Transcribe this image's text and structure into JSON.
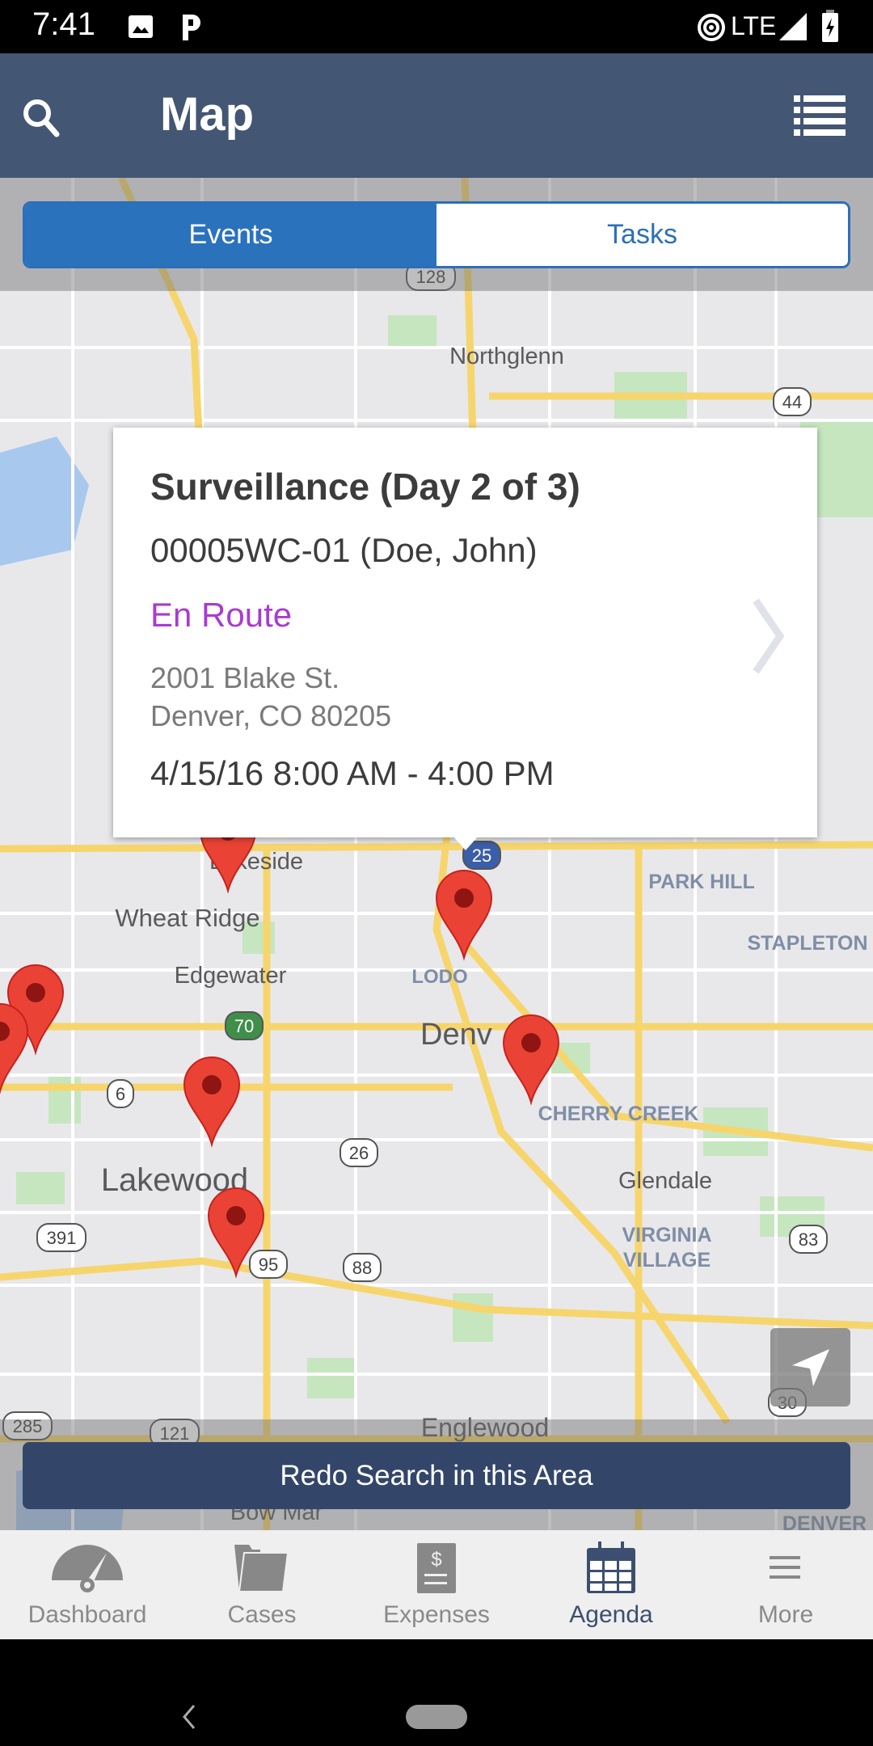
{
  "status_bar": {
    "time": "7:41",
    "network": "LTE",
    "icons": [
      "image-icon",
      "parking-icon",
      "hotspot-icon",
      "signal-icon",
      "battery-charging-icon"
    ]
  },
  "header": {
    "title": "Map",
    "search_icon": "search-icon",
    "list_icon": "list-icon"
  },
  "segment": {
    "tabs": [
      {
        "label": "Events",
        "selected": true
      },
      {
        "label": "Tasks",
        "selected": false
      }
    ]
  },
  "colors": {
    "header": "#435673",
    "accent": "#2b72bd",
    "status_en_route": "#a93bd0",
    "pin": "#ea4335",
    "redo_button": "#33466a",
    "active_tab": "#3c4f70"
  },
  "map": {
    "labels": [
      "Northglenn",
      "Lakeside",
      "Wheat Ridge",
      "Edgewater",
      "LODO",
      "Denv",
      "PARK HILL",
      "STAPLETON",
      "CHERRY CREEK",
      "Lakewood",
      "Glendale",
      "VIRGINIA",
      "VILLAGE",
      "Englewood",
      "Bow Mar",
      "DENVER"
    ],
    "shields": [
      "128",
      "44",
      "6",
      "70",
      "26",
      "391",
      "95",
      "88",
      "83",
      "30",
      "285",
      "121",
      "25"
    ],
    "pin_count": 7
  },
  "event_card": {
    "title": "Surveillance (Day 2 of 3)",
    "case": "00005WC-01 (Doe, John)",
    "status": "En Route",
    "address_line1": "2001 Blake St.",
    "address_line2": "Denver, CO 80205",
    "time_range": "4/15/16 8:00 AM - 4:00 PM"
  },
  "redo_button": "Redo Search in this Area",
  "tabbar": {
    "items": [
      {
        "label": "Dashboard",
        "icon": "dashboard-icon"
      },
      {
        "label": "Cases",
        "icon": "folder-icon"
      },
      {
        "label": "Expenses",
        "icon": "receipt-icon"
      },
      {
        "label": "Agenda",
        "icon": "calendar-icon",
        "active": true
      },
      {
        "label": "More",
        "icon": "menu-icon"
      }
    ]
  }
}
